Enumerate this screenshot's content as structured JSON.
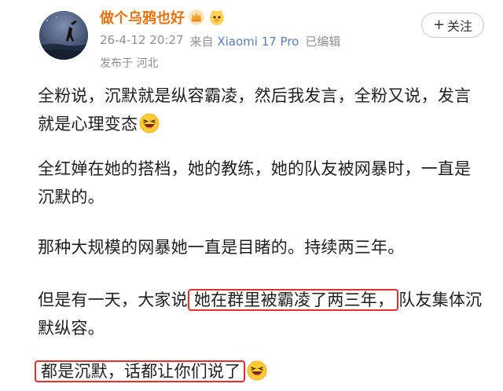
{
  "header": {
    "username": "做个乌鸦也好",
    "timestamp": "26-4-12 20:27",
    "source_prefix": "来自",
    "device": "Xiaomi 17 Pro",
    "edited": "已编辑",
    "location": "发布于 河北",
    "follow_label": "关注",
    "follow_plus": "+"
  },
  "post": {
    "p1": "全粉说，沉默就是纵容霸凌，然后我发言，全粉又说，发言就是心理变态",
    "p2": "全红婵在她的搭档，她的教练，她的队友被网暴时，一直是沉默的。",
    "p3": "那种大规模的网暴她一直是目睹的。持续两三年。",
    "p4_before": "但是有一天，大家说",
    "p4_highlight": "她在群里被霸凌了两三年，",
    "p4_after": "队友集体沉默纵容。",
    "p5_highlight": "都是沉默，话都让你们说了"
  },
  "colors": {
    "username": "#e8730b",
    "highlight_border": "#e0312e",
    "device_link": "#5b7fae"
  },
  "icons": [
    "avatar-image",
    "vip-crown-icon",
    "fan-badge-icon",
    "laughing-emoji-icon"
  ]
}
